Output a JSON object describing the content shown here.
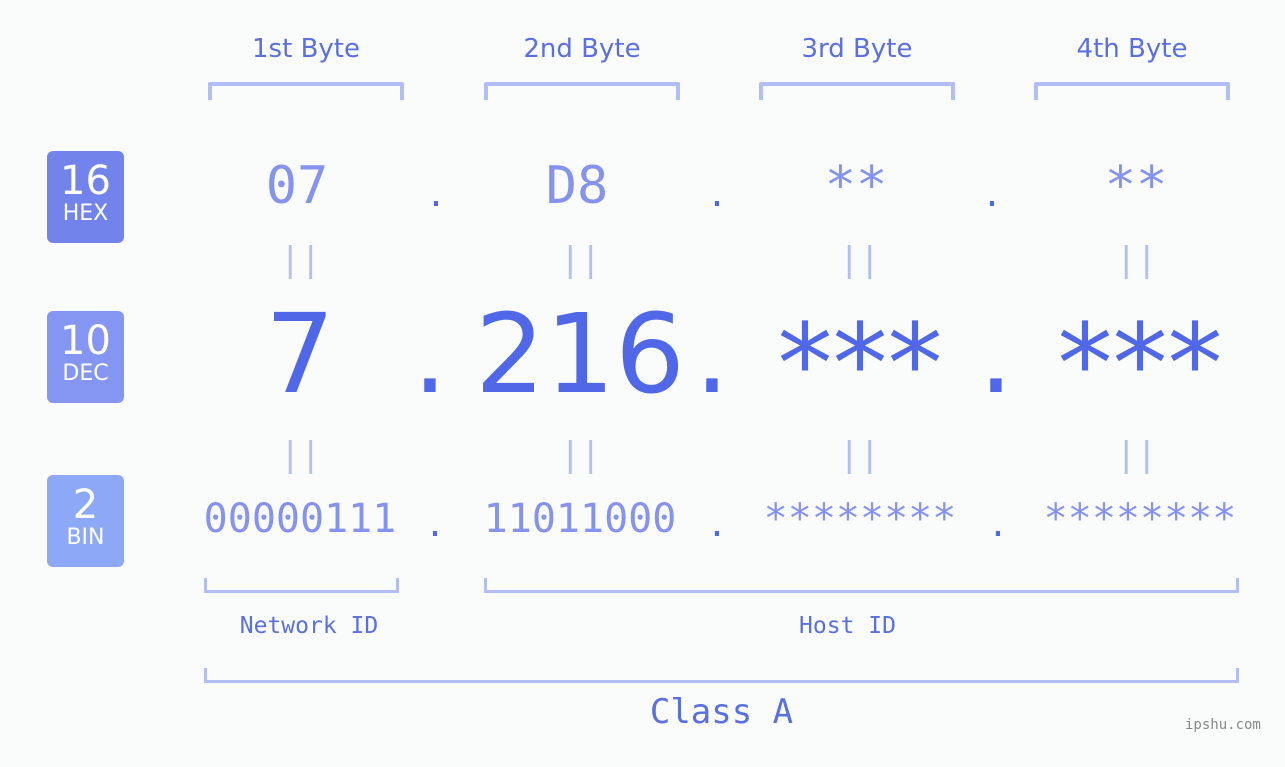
{
  "byte_headers": [
    "1st Byte",
    "2nd Byte",
    "3rd Byte",
    "4th Byte"
  ],
  "badges": [
    {
      "number": "16",
      "label": "HEX",
      "color": "#7284ec"
    },
    {
      "number": "10",
      "label": "DEC",
      "color": "#8595f2"
    },
    {
      "number": "2",
      "label": "BIN",
      "color": "#8ea8f8"
    }
  ],
  "hex": [
    "07",
    "D8",
    "**",
    "**"
  ],
  "dec": [
    "7",
    "216",
    "***",
    "***"
  ],
  "bin": [
    "00000111",
    "11011000",
    "********",
    "********"
  ],
  "separator": ".",
  "equals": "||",
  "network_label": "Network ID",
  "host_label": "Host ID",
  "class_label": "Class A",
  "watermark": "ipshu.com"
}
